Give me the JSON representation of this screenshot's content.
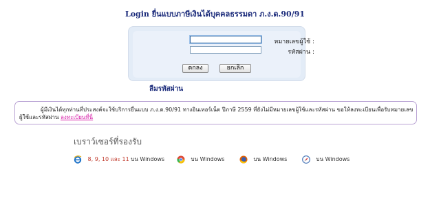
{
  "header": {
    "title": "Login ยื่นแบบภาษีเงินได้บุคคลธรรมดา ภ.ง.ด.90/91"
  },
  "login": {
    "username_label": "หมายเลขผู้ใช้ :",
    "username_value": "",
    "password_label": "รหัสผ่าน :",
    "password_value": "",
    "ok_label": "ตกลง",
    "cancel_label": "ยกเลิก"
  },
  "forgot_password": "ลืมรหัสผ่าน",
  "notice": {
    "text": "ผู้มีเงินได้ทุกท่านที่ประสงค์จะใช้บริการยื่นแบบ ภ.ง.ด.90/91 ทางอินเทอร์เน็ต ปีภาษี 2559 ที่ยังไม่มีหมายเลขผู้ใช้และรหัสผ่าน ขอให้ลงทะเบียนเพื่อรับหมายเลขผู้ใช้และรหัสผ่าน",
    "link": "ลงทะเบียนที่นี่"
  },
  "browsers": {
    "heading": "เบราว์เซอร์ที่รองรับ",
    "ie_versions": "8, 9, 10 และ 11",
    "ie_suffix": "บน Windows",
    "chrome": "บน Windows",
    "firefox": "บน Windows",
    "safari": "บน Windows",
    "icons": [
      "ie-icon",
      "chrome-icon",
      "firefox-icon",
      "safari-icon"
    ]
  },
  "colors": {
    "title": "#1a2a7a",
    "login_box_bg": "#e3ecf7",
    "notice_border": "#b9a3d4",
    "link": "#d61ea8",
    "ie_version_text": "#c0392b"
  }
}
